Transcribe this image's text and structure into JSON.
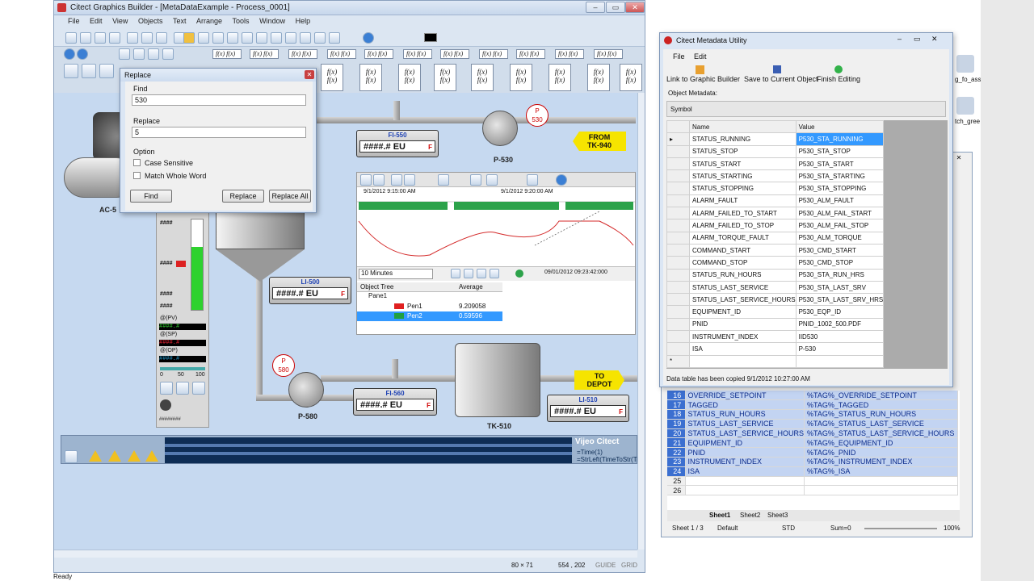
{
  "graphics_builder": {
    "title": "Citect Graphics Builder - [MetaDataExample - Process_0001]",
    "menu": [
      "File",
      "Edit",
      "View",
      "Objects",
      "Text",
      "Arrange",
      "Tools",
      "Window",
      "Help"
    ],
    "status": {
      "size": "80 × 71",
      "coords": "554 , 202",
      "guide": "GUIDE",
      "grid": "GRID"
    }
  },
  "replace_dialog": {
    "title": "Replace",
    "find_label": "Find",
    "find_value": "530",
    "replace_label": "Replace",
    "replace_value": "5",
    "option_label": "Option",
    "case_sensitive": "Case Sensitive",
    "whole_word": "Match Whole Word",
    "btn_find": "Find",
    "btn_replace": "Replace",
    "btn_replace_all": "Replace All"
  },
  "process": {
    "fi550": {
      "name": "FI-550",
      "value": "####.# EU",
      "flag": "F"
    },
    "li500": {
      "name": "LI-500",
      "value": "####.# EU",
      "flag": "F"
    },
    "fi560": {
      "name": "FI-560",
      "value": "####.# EU",
      "flag": "F"
    },
    "li510": {
      "name": "LI-510",
      "value": "####.# EU",
      "flag": "F"
    },
    "p530_badge": {
      "p": "P",
      "n": "530"
    },
    "p580_badge": {
      "p": "P",
      "n": "580"
    },
    "p530_label": "P-530",
    "p580_label": "P-580",
    "tk510_label": "TK-510",
    "ac_label": "AC-5",
    "from_tag": {
      "line1": "FROM",
      "line2": "TK-940"
    },
    "to_tag": {
      "line1": "TO",
      "line2": "DEPOT"
    },
    "faceplate": {
      "hash_top": "####",
      "hash_mid": "####",
      "hash_low1": "####",
      "hash_low2": "####",
      "pv": "@(PV)",
      "sp": "@(SP)",
      "op": "@(OP)",
      "pv_val": "####.#",
      "sp_val": "####.#",
      "op_val": "####.#",
      "scale": [
        "0",
        "50",
        "100"
      ],
      "bottom": "########",
      "level_fraction": 0.7
    },
    "vijeo": "Vijeo Citect",
    "expr1": "=Time(1)",
    "expr2": "=StrLeft(TimeToStr(Ti"
  },
  "trend": {
    "time1": "9/1/2012 9:15:00 AM",
    "time2": "9/1/2012 9:20:00 AM",
    "span": "10 Minutes",
    "datetime": "09/01/2012 09:23:42:000",
    "col_object": "Object Tree",
    "col_average": "Average",
    "pane": "Pane1",
    "pens": [
      {
        "name": "Pen1",
        "avg": "9.209058",
        "color": "#e02020"
      },
      {
        "name": "Pen2",
        "avg": "0.59596",
        "color": "#20a040"
      }
    ]
  },
  "metadata": {
    "title": "Citect Metadata Utility",
    "menu": [
      "File",
      "Edit"
    ],
    "toolbar": [
      "Link to Graphic Builder",
      "Save to Current Object",
      "Finish Editing"
    ],
    "object_metadata_label": "Object Metadata:",
    "symbol_label": "Symbol",
    "col_name": "Name",
    "col_value": "Value",
    "rows": [
      [
        "STATUS_RUNNING",
        "P530_STA_RUNNING"
      ],
      [
        "STATUS_STOP",
        "P530_STA_STOP"
      ],
      [
        "STATUS_START",
        "P530_STA_START"
      ],
      [
        "STATUS_STARTING",
        "P530_STA_STARTING"
      ],
      [
        "STATUS_STOPPING",
        "P530_STA_STOPPING"
      ],
      [
        "ALARM_FAULT",
        "P530_ALM_FAULT"
      ],
      [
        "ALARM_FAILED_TO_START",
        "P530_ALM_FAIL_START"
      ],
      [
        "ALARM_FAILED_TO_STOP",
        "P530_ALM_FAIL_STOP"
      ],
      [
        "ALARM_TORQUE_FAULT",
        "P530_ALM_TORQUE"
      ],
      [
        "COMMAND_START",
        "P530_CMD_START"
      ],
      [
        "COMMAND_STOP",
        "P530_CMD_STOP"
      ],
      [
        "STATUS_RUN_HOURS",
        "P530_STA_RUN_HRS"
      ],
      [
        "STATUS_LAST_SERVICE",
        "P530_STA_LAST_SRV"
      ],
      [
        "STATUS_LAST_SERVICE_HOURS",
        "P530_STA_LAST_SRV_HRS"
      ],
      [
        "EQUIPMENT_ID",
        "P530_EQP_ID"
      ],
      [
        "PNID",
        "PNID_1002_500.PDF"
      ],
      [
        "INSTRUMENT_INDEX",
        "IID530"
      ],
      [
        "ISA",
        "P-530"
      ]
    ],
    "new_row_marker": "*",
    "status": "Data table has been copied 9/1/2012 10:27:00 AM"
  },
  "spreadsheet": {
    "rows": [
      [
        "16",
        "OVERRIDE_SETPOINT",
        "%TAG%_OVERRIDE_SETPOINT"
      ],
      [
        "17",
        "TAGGED",
        "%TAG%_TAGGED"
      ],
      [
        "18",
        "STATUS_RUN_HOURS",
        "%TAG%_STATUS_RUN_HOURS"
      ],
      [
        "19",
        "STATUS_LAST_SERVICE",
        "%TAG%_STATUS_LAST_SERVICE"
      ],
      [
        "20",
        "STATUS_LAST_SERVICE_HOURS",
        "%TAG%_STATUS_LAST_SERVICE_HOURS"
      ],
      [
        "21",
        "EQUIPMENT_ID",
        "%TAG%_EQUIPMENT_ID"
      ],
      [
        "22",
        "PNID",
        "%TAG%_PNID"
      ],
      [
        "23",
        "INSTRUMENT_INDEX",
        "%TAG%_INSTRUMENT_INDEX"
      ],
      [
        "24",
        "ISA",
        "%TAG%_ISA"
      ],
      [
        "25",
        "",
        ""
      ],
      [
        "26",
        "",
        ""
      ]
    ],
    "tabs": [
      "Sheet1",
      "Sheet2",
      "Sheet3"
    ],
    "status_sheet": "Sheet 1 / 3",
    "status_default": "Default",
    "status_std": "STD",
    "status_sum": "Sum=0",
    "zoom": "100%"
  },
  "desktop": {
    "icon1": "g_fo_ass...",
    "icon2": "tch_gree",
    "ready": "Ready"
  },
  "colors": {
    "accent_blue": "#3399ff",
    "alarm_red": "#d00000",
    "tag_blue": "#1b3fb3",
    "yellow": "#f6e400"
  }
}
